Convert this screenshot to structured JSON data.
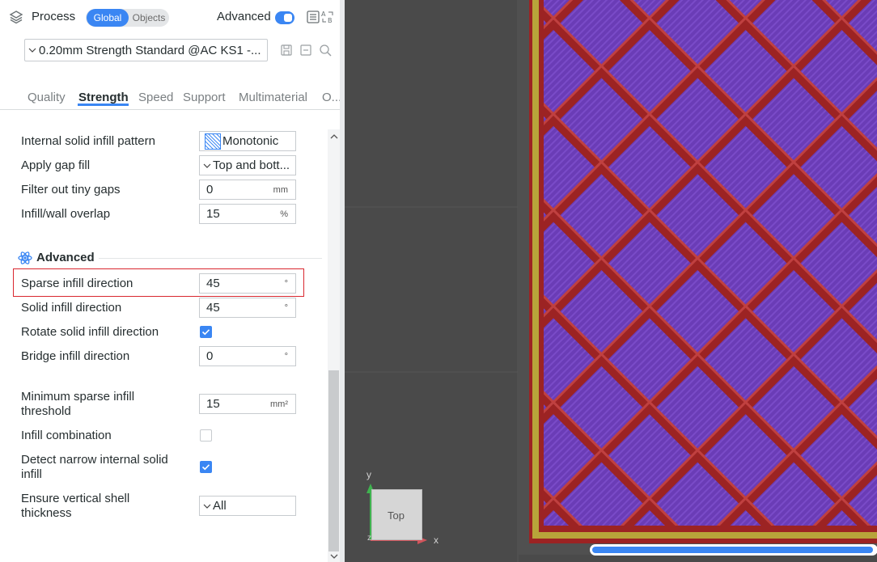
{
  "header": {
    "title": "Process",
    "scope_global": "Global",
    "scope_objects": "Objects",
    "advanced_label": "Advanced"
  },
  "preset": {
    "name": "0.20mm Strength Standard @AC KS1 -..."
  },
  "tabs": [
    {
      "label": "Quality"
    },
    {
      "label": "Strength"
    },
    {
      "label": "Speed"
    },
    {
      "label": "Support"
    },
    {
      "label": "Multimaterial"
    },
    {
      "label": "O..."
    }
  ],
  "rows": {
    "internal_solid_pattern": {
      "label": "Internal solid infill pattern",
      "value": "Monotonic"
    },
    "apply_gap_fill": {
      "label": "Apply gap fill",
      "value": "Top and bott..."
    },
    "filter_tiny_gaps": {
      "label": "Filter out tiny gaps",
      "value": "0",
      "unit": "mm"
    },
    "infill_wall_overlap": {
      "label": "Infill/wall overlap",
      "value": "15",
      "unit": "%"
    },
    "sparse_infill_direction": {
      "label": "Sparse infill direction",
      "value": "45",
      "unit": "°"
    },
    "solid_infill_direction": {
      "label": "Solid infill direction",
      "value": "45",
      "unit": "°"
    },
    "rotate_solid_infill": {
      "label": "Rotate solid infill direction",
      "checked": true
    },
    "bridge_infill_direction": {
      "label": "Bridge infill direction",
      "value": "0",
      "unit": "°"
    },
    "min_sparse_infill_l1": "Minimum sparse infill",
    "min_sparse_infill_l2": "threshold",
    "min_sparse_infill_value": "15",
    "min_sparse_infill_unit": "mm²",
    "infill_combination": {
      "label": "Infill combination",
      "checked": false
    },
    "detect_narrow_l1": "Detect narrow internal solid",
    "detect_narrow_l2": "infill",
    "ensure_vertical_l1": "Ensure vertical shell",
    "ensure_vertical_l2": "thickness",
    "ensure_vertical_value": "All"
  },
  "section": {
    "title": "Advanced"
  },
  "viewport": {
    "view_label": "Top",
    "axis_x": "x",
    "axis_y": "y",
    "axis_z": "z",
    "progress": 0.99
  },
  "colors": {
    "accent": "#3a86f3",
    "highlight": "#d9272f",
    "infill_purple": "#6c3fb8",
    "infill_wall": "#9c2323",
    "outline_yellow": "#b8a43a"
  }
}
